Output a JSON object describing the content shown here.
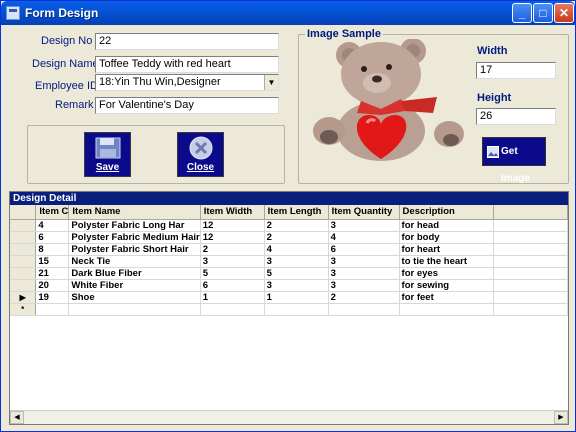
{
  "window": {
    "title": "Form Design"
  },
  "form": {
    "design_no_label": "Design No",
    "design_no_value": "22",
    "design_name_label": "Design Name",
    "design_name_value": "Toffee Teddy with red heart",
    "employee_label": "Employee ID",
    "employee_value": "18:Yin Thu Win,Designer",
    "remark_label": "Remark",
    "remark_value": "For Valentine's Day"
  },
  "buttons": {
    "save_label": "Save",
    "close_label": "Close",
    "get_image_label": "Get Image"
  },
  "image_sample": {
    "title": "Image Sample",
    "width_label": "Width",
    "width_value": "17",
    "height_label": "Height",
    "height_value": "26"
  },
  "grid": {
    "caption": "Design Detail",
    "columns": [
      "Item C",
      "Item Name",
      "Item Width",
      "Item Length",
      "Item Quantity",
      "Description"
    ],
    "rows": [
      [
        "4",
        "Polyster Fabric Long Har",
        "12",
        "2",
        "3",
        "for head"
      ],
      [
        "6",
        "Polyster Fabric Medium Hair",
        "12",
        "2",
        "4",
        "for body"
      ],
      [
        "8",
        "Polyster Fabric Short Hair",
        "2",
        "4",
        "6",
        "for heart"
      ],
      [
        "15",
        "Neck Tie",
        "3",
        "3",
        "3",
        "to tie the heart"
      ],
      [
        "21",
        "Dark Blue Fiber",
        "5",
        "5",
        "3",
        "for eyes"
      ],
      [
        "20",
        " White Fiber",
        "6",
        "3",
        "3",
        "for sewing"
      ],
      [
        "19",
        "Shoe",
        "1",
        "1",
        "2",
        "for feet"
      ]
    ],
    "current_row_marker": "▶",
    "new_row_marker": "*"
  },
  "colors": {
    "titlebar": "#0454d6",
    "button_bg": "#0b0a8a",
    "grid_caption": "#0a1e7e",
    "label_text": "#001a80"
  },
  "icons": [
    "form-icon",
    "minimize-icon",
    "maximize-icon",
    "close-icon",
    "floppy-disk-icon",
    "cancel-icon",
    "image-icon",
    "teddy-bear-image"
  ]
}
